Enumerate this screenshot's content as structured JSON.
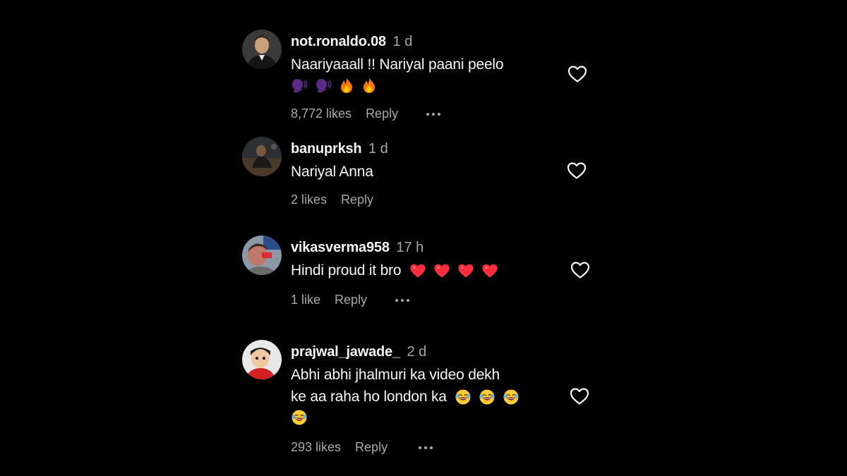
{
  "colors": {
    "background": "#000000",
    "primary_text": "#f5f5f5",
    "secondary_text": "#a8a8a8",
    "heart_red": "#ff2d3d",
    "fire": "#ff7a00",
    "speaking_head": "#5b2a86",
    "laugh": "#ffcc33"
  },
  "comments": [
    {
      "username": "not.ronaldo.08",
      "time": "1 d",
      "text": "Naariyaaall !! Nariyal paani peelo",
      "emojis": [
        "speaking-head-icon",
        "speaking-head-icon",
        "fire-icon",
        "fire-icon"
      ],
      "likes": "8,772 likes",
      "reply": "Reply"
    },
    {
      "username": "banuprksh",
      "time": "1 d",
      "text": "Nariyal Anna",
      "emojis": [],
      "likes": "2 likes",
      "reply": "Reply"
    },
    {
      "username": "vikasverma958",
      "time": "17 h",
      "text": "Hindi proud it bro",
      "emojis": [
        "red-heart-icon",
        "red-heart-icon",
        "red-heart-icon",
        "red-heart-icon"
      ],
      "likes": "1 like",
      "reply": "Reply"
    },
    {
      "username": "prajwal_jawade_",
      "time": "2 d",
      "text_line1": "Abhi abhi jhalmuri ka video dekh",
      "text_line2": "ke aa raha ho london ka",
      "emojis": [
        "laughing-tears-icon",
        "laughing-tears-icon",
        "laughing-tears-icon",
        "laughing-tears-icon"
      ],
      "likes": "293 likes",
      "reply": "Reply"
    }
  ]
}
